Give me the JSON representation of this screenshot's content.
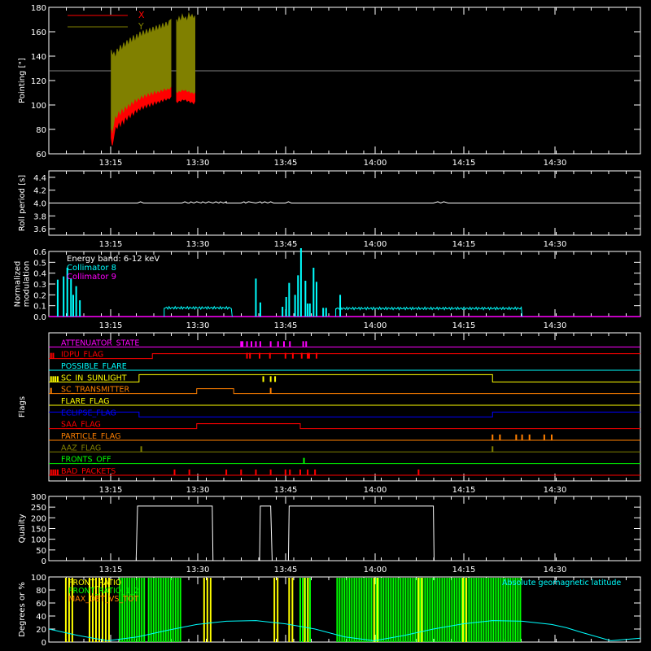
{
  "chart_data": [
    {
      "type": "line",
      "ylabel": "Pointing [\"]",
      "ylim": [
        60,
        180
      ],
      "yticks": [
        60,
        80,
        100,
        120,
        140,
        160,
        180
      ],
      "xticks": [
        "13:15",
        "13:30",
        "13:45",
        "14:00",
        "14:15",
        "14:30"
      ],
      "xlim_min": [
        0,
        106
      ],
      "reference_line": 128,
      "series": [
        {
          "name": "X",
          "color": "#ff0000",
          "segments": [
            {
              "x": [
                16.7,
                18,
                20,
                22,
                24,
                26,
                28,
                30,
                32,
                34,
                36,
                38,
                40,
                42,
                44,
                46,
                48,
                50,
                52,
                54,
                56,
                58,
                60,
                62,
                64,
                66,
                68,
                70,
                72,
                74,
                76,
                78,
                80,
                82,
                84,
                86,
                88,
                90
              ],
              "y": [
                80,
                74,
                82,
                90,
                88,
                94,
                90,
                96,
                92,
                98,
                95,
                100,
                97,
                102,
                99,
                104,
                101,
                105,
                103,
                107,
                104,
                108,
                105,
                109,
                106,
                110,
                107,
                111,
                108,
                111,
                109,
                112,
                110,
                113,
                111,
                113,
                112,
                114
              ]
            },
            {
              "x": [
                97,
                98,
                100,
                102,
                104,
                106,
                108,
                110,
                112,
                114,
                116,
                118,
                119.5
              ],
              "y": [
                110,
                109,
                111,
                110,
                112,
                111,
                112,
                110,
                111,
                109,
                110,
                108,
                110
              ]
            }
          ]
        },
        {
          "name": "Y",
          "color": "#808000",
          "segments": [
            {
              "x": [
                16.7,
                18,
                20,
                22,
                24,
                26,
                28,
                30,
                32,
                34,
                36,
                38,
                40,
                42,
                44,
                46,
                48,
                50,
                52,
                54,
                56,
                58,
                60,
                62,
                64,
                66,
                68,
                70,
                72,
                74,
                76,
                78,
                80,
                82,
                84,
                86,
                88,
                90
              ],
              "y": [
                145,
                140,
                143,
                138,
                146,
                142,
                149,
                144,
                151,
                146,
                153,
                148,
                155,
                150,
                157,
                151,
                158,
                153,
                160,
                155,
                161,
                156,
                162,
                157,
                163,
                158,
                164,
                159,
                165,
                160,
                166,
                161,
                167,
                162,
                168,
                163,
                169,
                170
              ]
            },
            {
              "x": [
                97,
                98,
                100,
                102,
                104,
                106,
                108,
                110,
                112,
                114,
                116,
                118,
                119.5
              ],
              "y": [
                170,
                166,
                172,
                168,
                174,
                170,
                172,
                168,
                175,
                171,
                174,
                170,
                173
              ]
            }
          ]
        }
      ]
    },
    {
      "type": "line",
      "ylabel": "Roll period [s]",
      "ylim": [
        3.5,
        4.5
      ],
      "yticks": [
        3.6,
        3.8,
        4.0,
        4.2,
        4.4
      ],
      "xticks": [
        "13:15",
        "13:30",
        "13:45",
        "14:00",
        "14:15",
        "14:30"
      ],
      "series": [
        {
          "name": "",
          "color": "#ffffff",
          "x": [
            0,
            120,
            124,
            128,
            180,
            184,
            188,
            190,
            192,
            196,
            200,
            206,
            208,
            212,
            216,
            222,
            226,
            230,
            232,
            236,
            240,
            240,
            260,
            264,
            266,
            270,
            280,
            286,
            288,
            292,
            296,
            300,
            304,
            320,
            324,
            328,
            340,
            420,
            500,
            510,
            520,
            526,
            530,
            534,
            540,
            560,
            680,
            800
          ],
          "y": [
            4.0,
            4.0,
            4.02,
            4.0,
            4.0,
            4.02,
            4.0,
            4.0,
            4.02,
            4.0,
            4.02,
            4.0,
            4.02,
            4.0,
            4.02,
            4.0,
            4.02,
            4.0,
            4.02,
            4.0,
            4.02,
            4.0,
            4.0,
            4.02,
            4.0,
            4.02,
            4.0,
            4.02,
            4.0,
            4.02,
            4.0,
            4.02,
            4.0,
            4.0,
            4.02,
            4.0,
            4.0,
            4.0,
            4.0,
            4.0,
            4.0,
            4.02,
            4.0,
            4.02,
            4.0,
            4.0,
            4.0,
            4.0
          ]
        }
      ]
    },
    {
      "type": "line",
      "ylabel": "Normalized\nmodulation",
      "ylim": [
        0,
        0.6
      ],
      "yticks": [
        0.0,
        0.1,
        0.2,
        0.3,
        0.4,
        0.5,
        0.6
      ],
      "xticks": [
        "13:15",
        "13:30",
        "13:45",
        "14:00",
        "14:15",
        "14:30"
      ],
      "legend": [
        "Energy band: 6-12 keV",
        "Collimator 8",
        "Collimator 9"
      ],
      "legend_colors": [
        "#ffffff",
        "#00ffff",
        "#ff00ff"
      ],
      "series": [
        {
          "name": "Collimator 8",
          "color": "#00ffff",
          "spikes": [
            [
              12,
              0.34
            ],
            [
              20,
              0.37
            ],
            [
              25,
              0.45
            ],
            [
              30,
              0.35
            ],
            [
              33,
              0.2
            ],
            [
              37,
              0.28
            ],
            [
              42,
              0.15
            ],
            [
              280,
              0.35
            ],
            [
              286,
              0.13
            ],
            [
              316,
              0.09
            ],
            [
              321,
              0.18
            ],
            [
              325,
              0.31
            ],
            [
              333,
              0.2
            ],
            [
              337,
              0.38
            ],
            [
              341,
              0.63
            ],
            [
              347,
              0.33
            ],
            [
              350,
              0.12
            ],
            [
              353,
              0.12
            ],
            [
              358,
              0.45
            ],
            [
              362,
              0.32
            ],
            [
              371,
              0.08
            ],
            [
              375,
              0.08
            ],
            [
              394,
              0.2
            ]
          ],
          "plateaus": [
            [
              156,
              248,
              0.08
            ],
            [
              388,
              640,
              0.075
            ]
          ]
        },
        {
          "name": "Collimator 9",
          "color": "#ff00ff",
          "baseline": 0.0
        }
      ]
    },
    {
      "type": "line",
      "ylabel": "Flags",
      "flags": [
        {
          "name": "ATTENUATOR_STATE",
          "color": "#ff00ff"
        },
        {
          "name": "IDPU_FLAG",
          "color": "#ff0000"
        },
        {
          "name": "POSSIBLE_FLARE",
          "color": "#00ffff"
        },
        {
          "name": "SC_IN_SUNLIGHT",
          "color": "#ffff00"
        },
        {
          "name": "SC_TRANSMITTER",
          "color": "#ff8000"
        },
        {
          "name": "FLARE_FLAG",
          "color": "#ffff00"
        },
        {
          "name": "ECLIPSE_FLAG",
          "color": "#0000ff"
        },
        {
          "name": "SAA_FLAG",
          "color": "#ff0000"
        },
        {
          "name": "PARTICLE_FLAG",
          "color": "#ff8000"
        },
        {
          "name": "AAZ_FLAG",
          "color": "#808000"
        },
        {
          "name": "FRONTS_OFF",
          "color": "#00ff00"
        },
        {
          "name": "BAD_PACKETS",
          "color": "#ff0000"
        }
      ],
      "xticks": [
        "13:15",
        "13:30",
        "13:45",
        "14:00",
        "14:15",
        "14:30"
      ]
    },
    {
      "type": "line",
      "ylabel": "Quality",
      "ylim": [
        0,
        300
      ],
      "yticks": [
        0,
        50,
        100,
        150,
        200,
        250,
        300
      ],
      "xticks": [
        "13:15",
        "13:30",
        "13:45",
        "14:00",
        "14:15",
        "14:30"
      ],
      "series": [
        {
          "name": "",
          "color": "#ffffff",
          "x": [
            0,
            118,
            120,
            221,
            222,
            285,
            286,
            300,
            302,
            324,
            325,
            520,
            521,
            800
          ],
          "y": [
            0,
            0,
            255,
            255,
            0,
            0,
            255,
            255,
            0,
            0,
            255,
            255,
            0,
            0
          ]
        }
      ]
    },
    {
      "type": "line",
      "ylabel": "Degrees or %",
      "ylim": [
        0,
        100
      ],
      "yticks": [
        0,
        20,
        40,
        60,
        80,
        100
      ],
      "xticks": [
        "13:15",
        "13:30",
        "13:45",
        "14:00",
        "14:15",
        "14:30"
      ],
      "legend": [
        "FRONT_RATIO",
        "FRONT_RATIO_1_2",
        "MAX_DET_VS_TOT",
        "Absolute geomagnetic latitude"
      ],
      "legend_colors": [
        "#ffff00",
        "#00ff00",
        "#ff8000",
        "#00ffff"
      ],
      "series": [
        {
          "name": "Absolute geomagnetic latitude",
          "color": "#00ffff",
          "x": [
            0,
            40,
            80,
            120,
            160,
            200,
            240,
            280,
            320,
            340,
            360,
            400,
            440,
            480,
            520,
            560,
            600,
            640,
            680,
            700,
            720,
            760,
            800
          ],
          "y": [
            20,
            10,
            2,
            8,
            18,
            27,
            32,
            33,
            28,
            24,
            20,
            8,
            2,
            10,
            20,
            28,
            33,
            32,
            27,
            22,
            15,
            2,
            6
          ]
        }
      ],
      "bands": {
        "FRONT_RATIO_1_2": [
          [
            96,
            130
          ],
          [
            135,
            178
          ],
          [
            340,
            356
          ],
          [
            390,
            640
          ]
        ],
        "FRONT_RATIO": [
          [
            23,
            35
          ],
          [
            55,
            85
          ],
          [
            210,
            220
          ],
          [
            305,
            312
          ],
          [
            325,
            331
          ],
          [
            346,
            352
          ],
          [
            440,
            446
          ],
          [
            500,
            506
          ],
          [
            560,
            566
          ]
        ]
      }
    }
  ]
}
